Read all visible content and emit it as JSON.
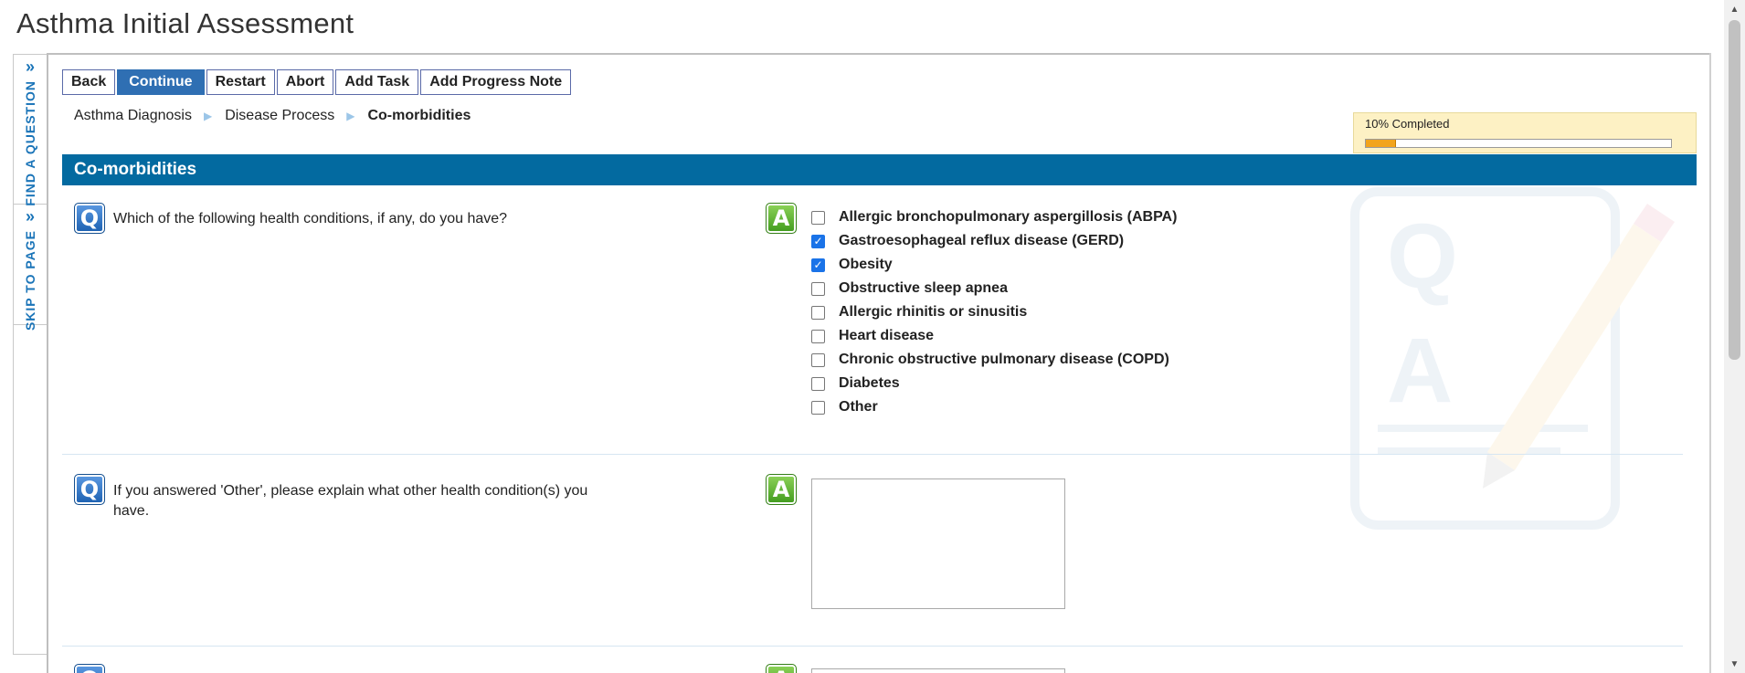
{
  "page": {
    "title": "Asthma Initial Assessment"
  },
  "side_rail": {
    "find_question": "FIND A QUESTION",
    "skip_to_page": "SKIP TO PAGE"
  },
  "toolbar": {
    "back": "Back",
    "continue": "Continue",
    "restart": "Restart",
    "abort": "Abort",
    "add_task": "Add Task",
    "add_progress_note": "Add Progress Note"
  },
  "breadcrumb": [
    "Asthma Diagnosis",
    "Disease Process",
    "Co-morbidities"
  ],
  "progress": {
    "label": "10% Completed",
    "percent": 10
  },
  "section": {
    "title": "Co-morbidities"
  },
  "questions": [
    {
      "icon": "Q",
      "text": "Which of the following health conditions, if any, do you have?",
      "answer_icon": "A",
      "options": [
        {
          "label": "Allergic bronchopulmonary aspergillosis (ABPA)",
          "checked": false
        },
        {
          "label": "Gastroesophageal reflux disease (GERD)",
          "checked": true
        },
        {
          "label": "Obesity",
          "checked": true
        },
        {
          "label": "Obstructive sleep apnea",
          "checked": false
        },
        {
          "label": "Allergic rhinitis or sinusitis",
          "checked": false
        },
        {
          "label": "Heart disease",
          "checked": false
        },
        {
          "label": "Chronic obstructive pulmonary disease (COPD)",
          "checked": false
        },
        {
          "label": "Diabetes",
          "checked": false
        },
        {
          "label": "Other",
          "checked": false
        }
      ]
    },
    {
      "icon": "Q",
      "text": "If you answered 'Other', please explain what other health condition(s) you have.",
      "answer_icon": "A",
      "answer_value": ""
    }
  ],
  "colors": {
    "accent": "#036aa0",
    "primary_button": "#2f6fb3",
    "progress_fill": "#f2a41d",
    "progress_bg": "#fdf1c4",
    "checkbox_checked": "#1a73e8"
  }
}
